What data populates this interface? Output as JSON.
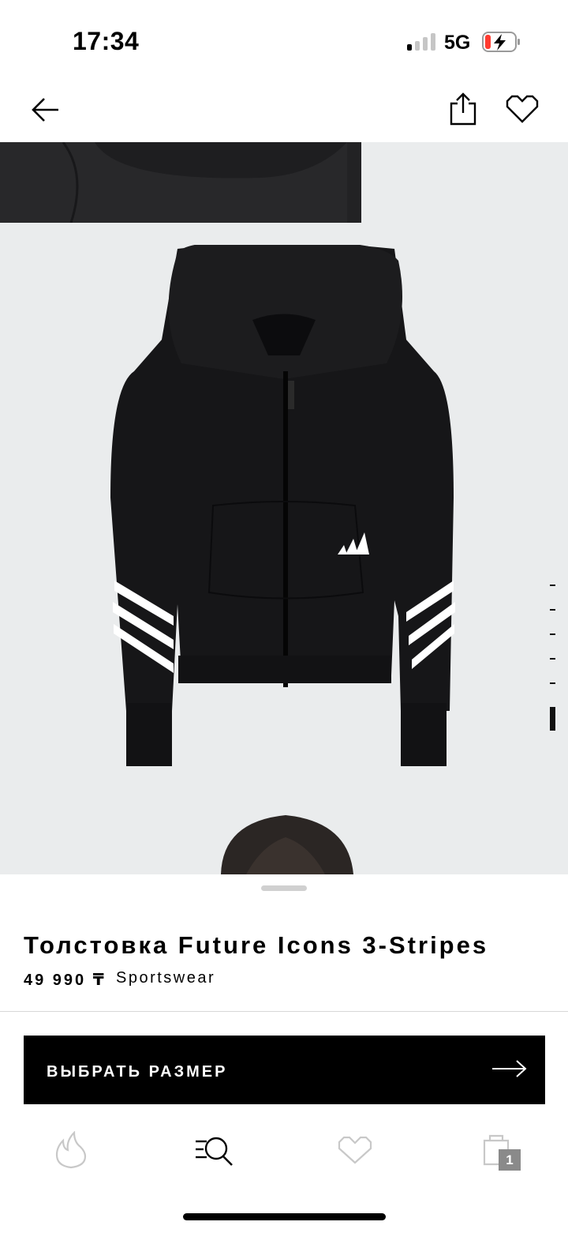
{
  "status_bar": {
    "time": "17:34",
    "network": "5G",
    "signal_bars_active": 1,
    "signal_bars_total": 4,
    "battery": "charging-low"
  },
  "header": {
    "back_icon": "arrow-left-icon",
    "share_icon": "share-icon",
    "wishlist_icon": "heart-icon"
  },
  "gallery": {
    "image_count": 6,
    "active_index": 6,
    "images": [
      "product-photo-detail",
      "product-photo-hoodie-front",
      "product-photo-model"
    ]
  },
  "product": {
    "title": "Толстовка Future Icons 3-Stripes",
    "price": "49 990 ₸",
    "brand_line": "Sportswear",
    "cta_label": "ВЫБРАТЬ РАЗМЕР"
  },
  "tabbar": {
    "items": [
      {
        "icon": "flame-icon"
      },
      {
        "icon": "search-icon"
      },
      {
        "icon": "heart-icon"
      },
      {
        "icon": "bag-icon",
        "badge": "1"
      }
    ]
  },
  "colors": {
    "accent": "#000000",
    "gallery_bg": "#eaeced",
    "tab_inactive": "#c8c8c8",
    "badge_bg": "#8a8a8a"
  }
}
